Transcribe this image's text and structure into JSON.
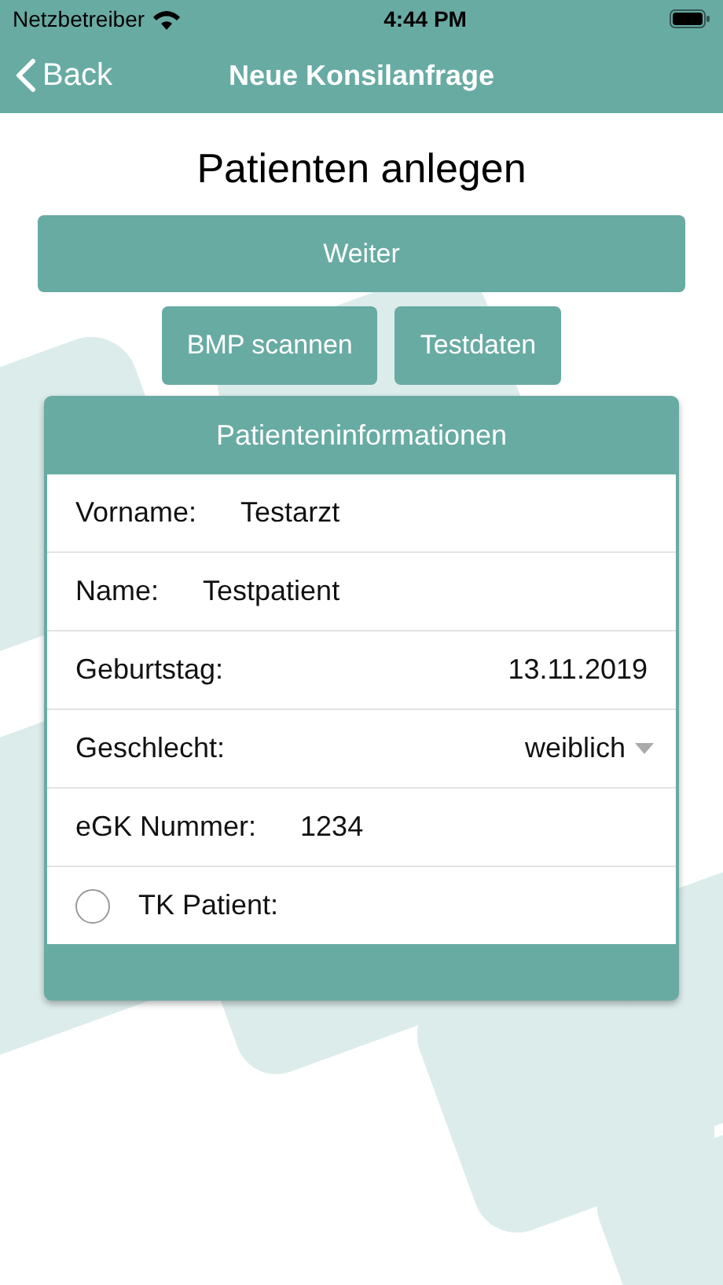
{
  "status_bar": {
    "carrier": "Netzbetreiber",
    "time": "4:44 PM"
  },
  "nav_bar": {
    "back": "Back",
    "title": "Neue Konsilanfrage"
  },
  "page_title": "Patienten anlegen",
  "primary_button": "Weiter",
  "buttons": [
    "BMP scannen",
    "Testdaten"
  ],
  "card": {
    "title": "Patienteninformationen",
    "rows": [
      {
        "kind": "text",
        "label": "Vorname:",
        "value": "Testarzt"
      },
      {
        "kind": "text",
        "label": "Name:",
        "value": "Testpatient"
      },
      {
        "kind": "date",
        "label": "Geburtstag:",
        "value": "13.11.2019"
      },
      {
        "kind": "select",
        "label": "Geschlecht:",
        "value": "weiblich"
      },
      {
        "kind": "text",
        "label": "eGK Nummer:",
        "value": "1234"
      },
      {
        "kind": "radio",
        "label": "TK Patient:",
        "checked": false
      }
    ]
  }
}
